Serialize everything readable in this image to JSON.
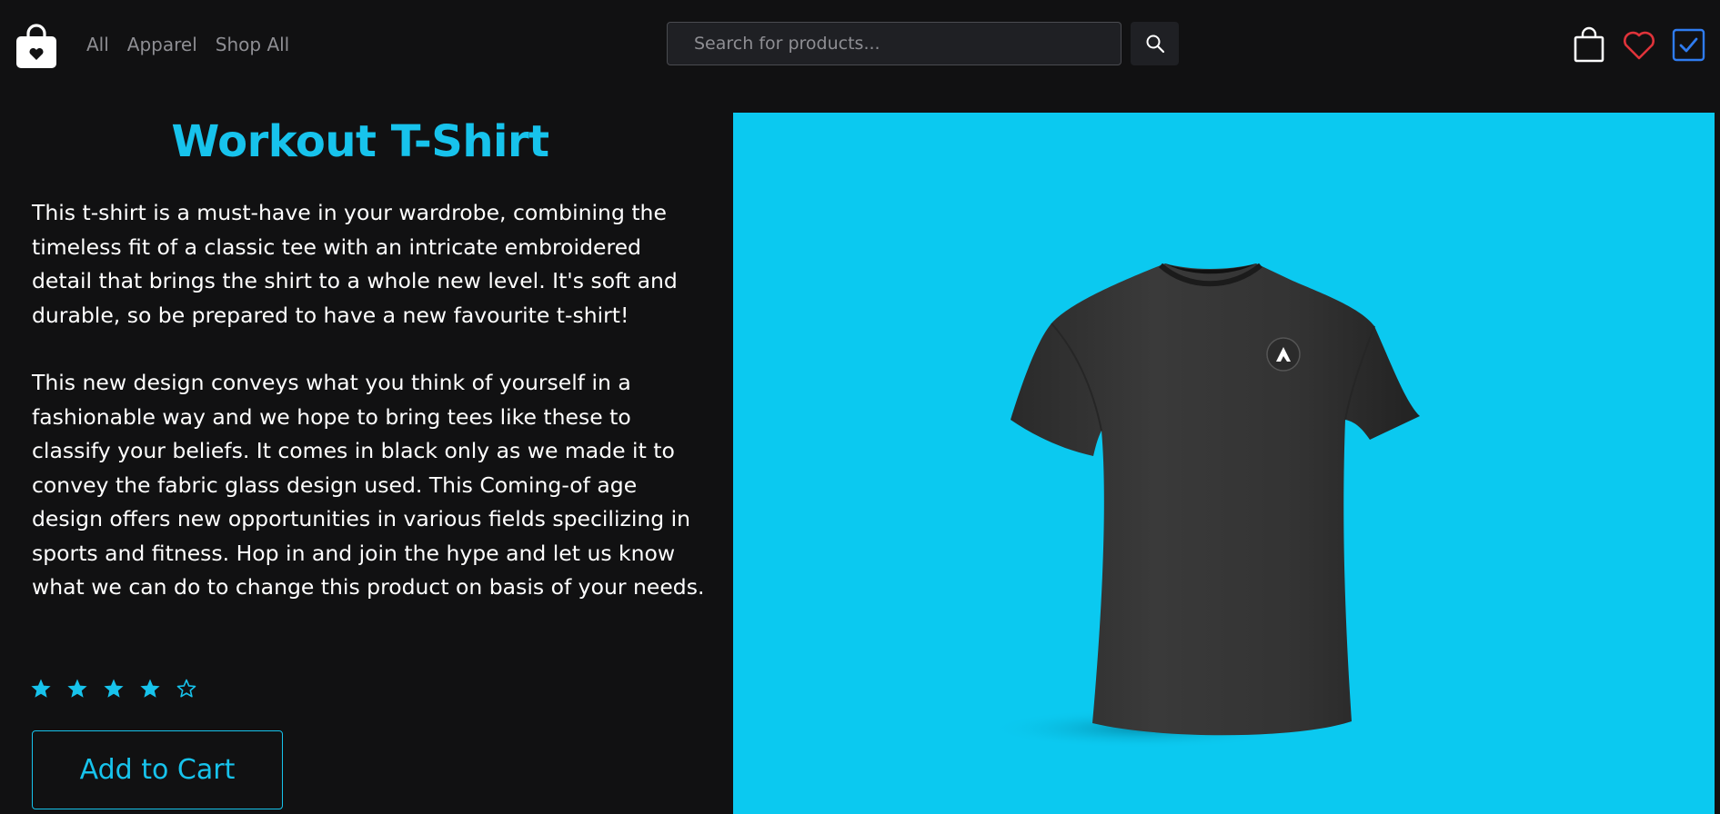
{
  "colors": {
    "background": "#111112",
    "accent": "#17c3ec",
    "product_bg": "#0bc9f0",
    "heart": "#e0333a",
    "check": "#2f7cf0"
  },
  "header": {
    "logo_icon": "shopping-bag-heart-icon",
    "nav": [
      "All",
      "Apparel",
      "Shop All"
    ],
    "search": {
      "placeholder": "Search for products...",
      "value": ""
    },
    "icons": [
      "search-icon",
      "bag-icon",
      "heart-icon",
      "check-icon"
    ]
  },
  "product": {
    "title": "Workout T-Shirt",
    "description_1": "This t-shirt is a must-have in your wardrobe, combining the timeless fit of a classic tee with an intricate embroidered detail that brings the shirt to a whole new level. It's soft and durable, so be prepared to have a new favourite t-shirt!",
    "description_2": "This new design conveys what you think of yourself in a fashionable way and we hope to bring tees like these to classify your beliefs. It comes in black only as we made it to convey the fabric glass design used. This Coming-of age design offers new opportunities in various fields specilizing in sports and fitness. Hop in and join the hype and let us know what we can do to change this product on basis of your needs.",
    "rating": 4,
    "rating_max": 5,
    "add_to_cart_label": "Add to Cart",
    "image_icon": "black-tshirt-image"
  }
}
